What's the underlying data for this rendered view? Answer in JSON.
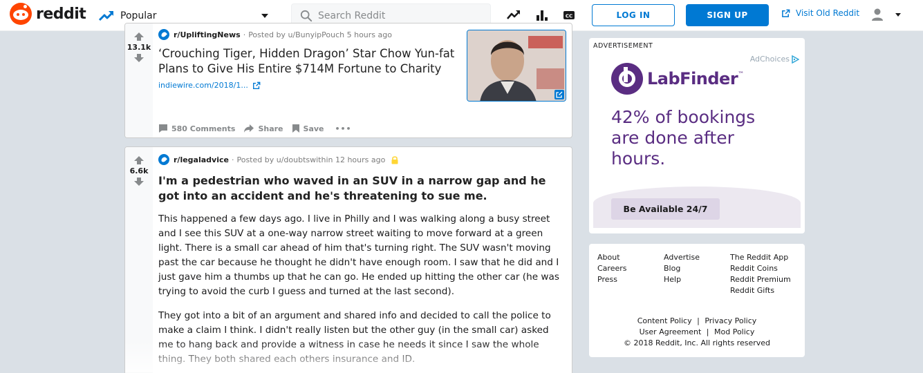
{
  "header": {
    "brand": "reddit",
    "feed_label": "Popular",
    "search_placeholder": "Search Reddit",
    "login_label": "LOG IN",
    "signup_label": "SIGN UP",
    "old_reddit_label": "Visit Old Reddit"
  },
  "posts": [
    {
      "score": "13.1k",
      "subreddit": "r/UpliftingNews",
      "posted_by": "Posted by u/BunyipPouch 5 hours ago",
      "title": "‘Crouching Tiger, Hidden Dragon’ Star Chow Yun-fat Plans to Give His Entire $714M Fortune to Charity",
      "link": "indiewire.com/2018/1...",
      "comments": "580 Comments",
      "share": "Share",
      "save": "Save",
      "more": "•••"
    },
    {
      "score": "6.6k",
      "subreddit": "r/legaladvice",
      "posted_by": "Posted by u/doubtswithin 12 hours ago",
      "title": "I'm a pedestrian who waved in an SUV in a narrow gap and he got into an accident and he's threatening to sue me.",
      "paragraph1": "This happened a few days ago. I live in Philly and I was walking along a busy street and I see this SUV at a one-way narrow street waiting to move forward at a green light. There is a small car ahead of him that's turning right. The SUV wasn't moving past the car because he thought he didn't have enough room. I saw that he did and I just gave him a thumbs up that he can go. He ended up hitting the other car (he was trying to avoid the curb I guess and turned at the last second).",
      "paragraph2": "They got into a bit of an argument and shared info and decided to call the police to make a claim I think. I didn't really listen but the other guy (in the small car) asked me to hang back and provide a witness in case he needs it since I saw the whole thing. They both shared each others insurance and ID."
    }
  ],
  "ad": {
    "label": "ADVERTISEMENT",
    "adchoices": "AdChoices",
    "brand": "LabFinder",
    "trademark": "™",
    "headline": "42% of bookings are done after hours.",
    "cta": "Be Available 24/7"
  },
  "footer": {
    "col1": [
      "About",
      "Careers",
      "Press"
    ],
    "col2": [
      "Advertise",
      "Blog",
      "Help"
    ],
    "col3": [
      "The Reddit App",
      "Reddit Coins",
      "Reddit Premium",
      "Reddit Gifts"
    ],
    "content_policy": "Content Policy",
    "privacy_policy": "Privacy Policy",
    "user_agreement": "User Agreement",
    "mod_policy": "Mod Policy",
    "separator": "|",
    "copyright": "© 2018 Reddit, Inc. All rights reserved"
  },
  "colors": {
    "brand_orange": "#ff4500",
    "link_blue": "#0079d3",
    "ad_purple": "#5a2d82",
    "page_bg": "#dae0e6"
  }
}
